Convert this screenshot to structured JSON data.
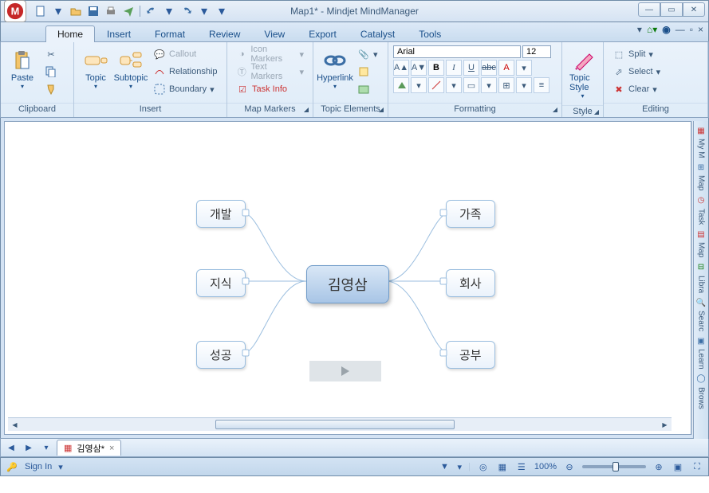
{
  "title": "Map1* - Mindjet MindManager",
  "tabs": [
    "Home",
    "Insert",
    "Format",
    "Review",
    "View",
    "Export",
    "Catalyst",
    "Tools"
  ],
  "active_tab": 0,
  "ribbon": {
    "clipboard": {
      "paste": "Paste",
      "label": "Clipboard"
    },
    "insert": {
      "topic": "Topic",
      "subtopic": "Subtopic",
      "callout": "Callout",
      "relationship": "Relationship",
      "boundary": "Boundary",
      "label": "Insert"
    },
    "markers": {
      "icon": "Icon Markers",
      "text": "Text Markers",
      "taskinfo": "Task Info",
      "label": "Map Markers"
    },
    "topicelem": {
      "hyperlink": "Hyperlink",
      "label": "Topic Elements"
    },
    "formatting": {
      "font": "Arial",
      "size": "12",
      "label": "Formatting"
    },
    "style": {
      "topicstyle": "Topic Style",
      "label": "Style"
    },
    "editing": {
      "split": "Split",
      "select": "Select",
      "clear": "Clear",
      "label": "Editing"
    }
  },
  "map": {
    "central": "김영삼",
    "left": [
      "개발",
      "지식",
      "성공"
    ],
    "right": [
      "가족",
      "회사",
      "공부"
    ]
  },
  "doctab": "김영삼*",
  "side": [
    "My M",
    "Map",
    "Task",
    "Map",
    "Libra",
    "Searc",
    "Learn",
    "Brows"
  ],
  "status": {
    "signin": "Sign In",
    "zoom": "100%"
  }
}
